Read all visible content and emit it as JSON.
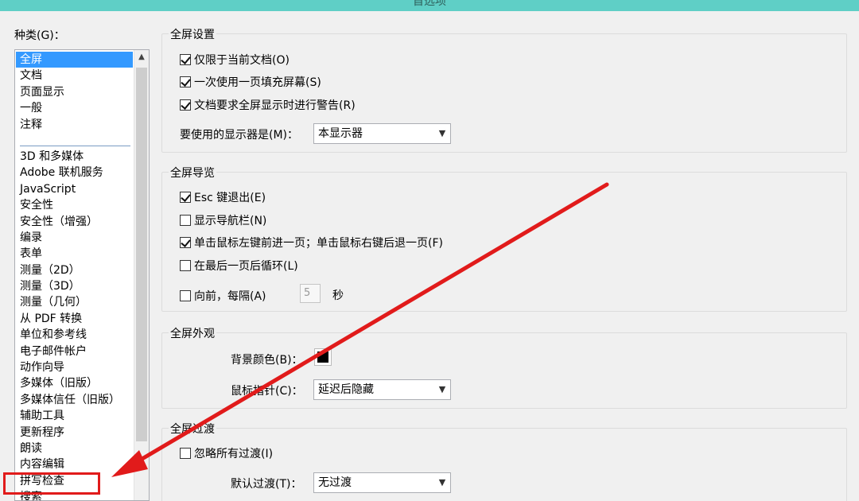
{
  "window": {
    "title": "首选项",
    "title_bar_color": "#5fcfc6"
  },
  "categories": {
    "label": "种类(G)：",
    "group_a": [
      "全屏",
      "文档",
      "页面显示",
      "一般",
      "注释"
    ],
    "group_b": [
      "3D 和多媒体",
      "Adobe 联机服务",
      "JavaScript",
      "安全性",
      "安全性（增强）",
      "编录",
      "表单",
      "测量（2D）",
      "测量（3D）",
      "测量（几何）",
      "从 PDF 转换",
      "单位和参考线",
      "电子邮件帐户",
      "动作向导",
      "多媒体（旧版）",
      "多媒体信任（旧版）",
      "辅助工具",
      "更新程序",
      "朗读",
      "内容编辑",
      "拼写检查",
      "搜索"
    ],
    "selected": "全屏"
  },
  "fullscreen_setup": {
    "title": "全屏设置",
    "options": [
      {
        "label": "仅限于当前文档(O)",
        "checked": true
      },
      {
        "label": "一次使用一页填充屏幕(S)",
        "checked": true
      },
      {
        "label": "文档要求全屏显示时进行警告(R)",
        "checked": true
      }
    ],
    "monitor_label": "要使用的显示器是(M)：",
    "monitor_value": "本显示器"
  },
  "fullscreen_nav": {
    "title": "全屏导览",
    "options": [
      {
        "label": "Esc 键退出(E)",
        "checked": true
      },
      {
        "label": "显示导航栏(N)",
        "checked": false
      },
      {
        "label": "单击鼠标左键前进一页；单击鼠标右键后退一页(F)",
        "checked": true
      },
      {
        "label": "在最后一页后循环(L)",
        "checked": false
      }
    ],
    "advance_label": "向前，每隔(A)",
    "advance_checked": false,
    "advance_seconds": "5",
    "seconds_unit": "秒"
  },
  "fullscreen_appearance": {
    "title": "全屏外观",
    "bg_color_label": "背景颜色(B)：",
    "bg_color": "#000000",
    "cursor_label": "鼠标指针(C)：",
    "cursor_value": "延迟后隐藏"
  },
  "fullscreen_transition": {
    "title": "全屏过渡",
    "ignore_label": "忽略所有过渡(I)",
    "ignore_checked": false,
    "default_label": "默认过渡(T)：",
    "default_value": "无过渡"
  },
  "annotation": {
    "color": "#e11b1b",
    "target_icon": "red-arrow-annotation"
  }
}
